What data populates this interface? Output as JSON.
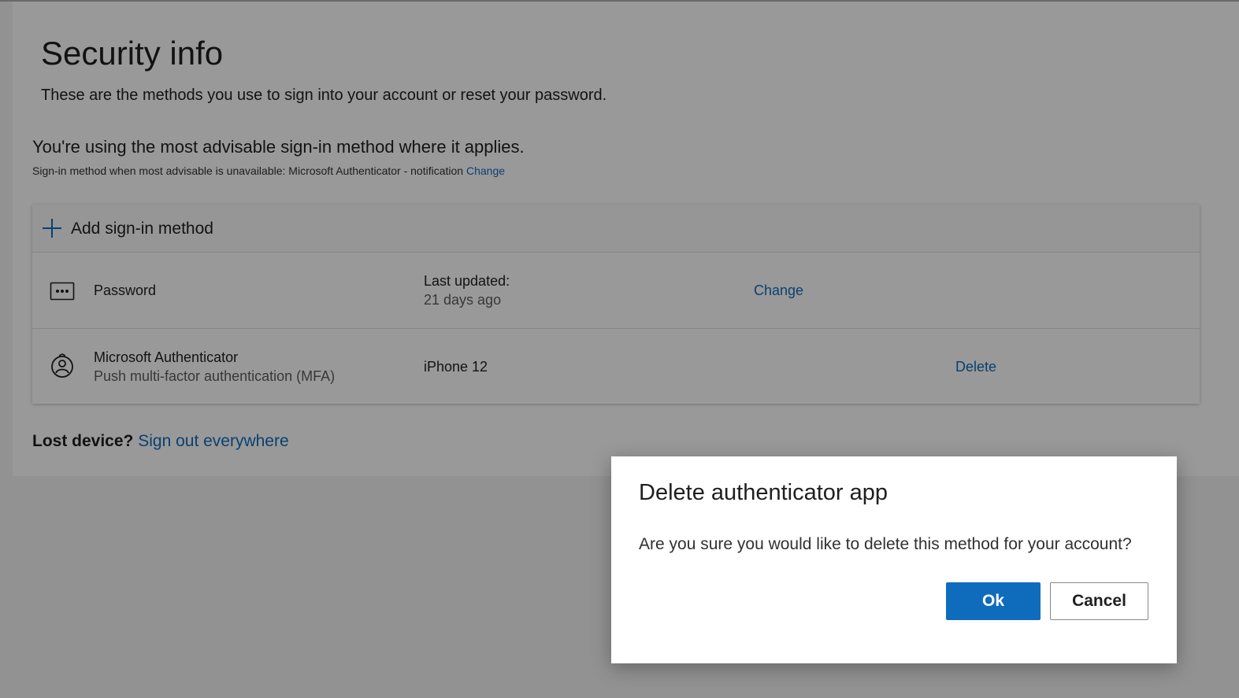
{
  "page": {
    "title": "Security info",
    "subtitle": "These are the methods you use to sign into your account or reset your password."
  },
  "advisable": {
    "heading": "You're using the most advisable sign-in method where it applies.",
    "fallback_text": "Sign-in method when most advisable is unavailable: Microsoft Authenticator - notification",
    "change_link": "Change"
  },
  "methods": {
    "add_label": "Add sign-in method",
    "items": [
      {
        "icon": "password-dots-icon",
        "name": "Password",
        "detail_label": "Last updated:",
        "detail_value": "21 days ago",
        "action": "Change"
      },
      {
        "icon": "authenticator-lock-icon",
        "name": "Microsoft Authenticator",
        "subtitle": "Push multi-factor authentication (MFA)",
        "detail_value": "iPhone 12",
        "action": "Delete"
      }
    ]
  },
  "lost_device": {
    "label": "Lost device?",
    "link": "Sign out everywhere"
  },
  "dialog": {
    "title": "Delete authenticator app",
    "message": "Are you sure you would like to delete this method for your account?",
    "ok_label": "Ok",
    "cancel_label": "Cancel"
  },
  "colors": {
    "accent": "#0f6cbd",
    "text": "#201f1e",
    "muted_text": "#605e5c",
    "overlay": "rgba(0,0,0,0.4)"
  }
}
